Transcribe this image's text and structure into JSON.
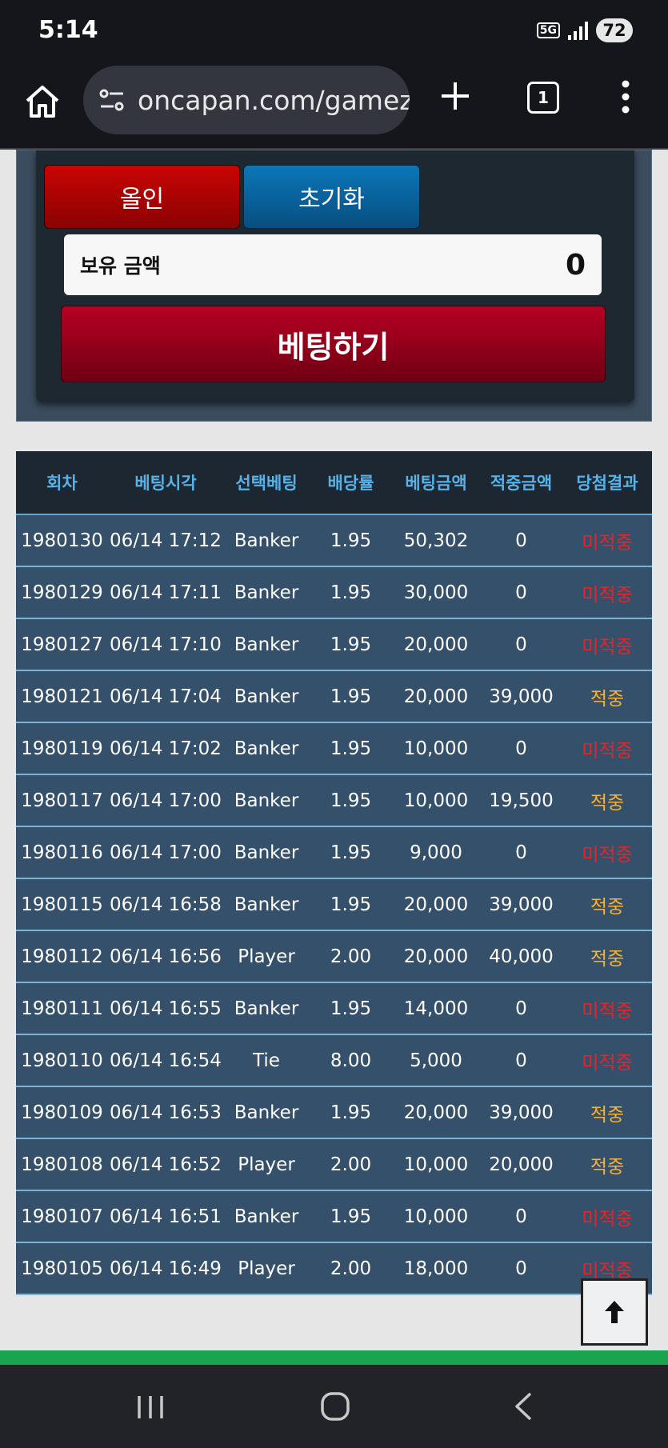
{
  "status_bar": {
    "time": "5:14",
    "network": "5G",
    "battery": "72"
  },
  "browser": {
    "url": "oncapan.com/gamez",
    "tab_count": "1"
  },
  "bet_panel": {
    "allin_label": "올인",
    "reset_label": "초기화",
    "balance_label": "보유 금액",
    "balance_value": "0",
    "bet_button_label": "베팅하기"
  },
  "history": {
    "headers": [
      "회차",
      "베팅시각",
      "선택베팅",
      "배당률",
      "베팅금액",
      "적중금액",
      "당첨결과"
    ],
    "rows": [
      {
        "round": "1980130",
        "time": "06/14 17:12",
        "choice": "Banker",
        "odds": "1.95",
        "amount": "50,302",
        "payout": "0",
        "result": "미적중",
        "win": false
      },
      {
        "round": "1980129",
        "time": "06/14 17:11",
        "choice": "Banker",
        "odds": "1.95",
        "amount": "30,000",
        "payout": "0",
        "result": "미적중",
        "win": false
      },
      {
        "round": "1980127",
        "time": "06/14 17:10",
        "choice": "Banker",
        "odds": "1.95",
        "amount": "20,000",
        "payout": "0",
        "result": "미적중",
        "win": false
      },
      {
        "round": "1980121",
        "time": "06/14 17:04",
        "choice": "Banker",
        "odds": "1.95",
        "amount": "20,000",
        "payout": "39,000",
        "result": "적중",
        "win": true
      },
      {
        "round": "1980119",
        "time": "06/14 17:02",
        "choice": "Banker",
        "odds": "1.95",
        "amount": "10,000",
        "payout": "0",
        "result": "미적중",
        "win": false
      },
      {
        "round": "1980117",
        "time": "06/14 17:00",
        "choice": "Banker",
        "odds": "1.95",
        "amount": "10,000",
        "payout": "19,500",
        "result": "적중",
        "win": true
      },
      {
        "round": "1980116",
        "time": "06/14 17:00",
        "choice": "Banker",
        "odds": "1.95",
        "amount": "9,000",
        "payout": "0",
        "result": "미적중",
        "win": false
      },
      {
        "round": "1980115",
        "time": "06/14 16:58",
        "choice": "Banker",
        "odds": "1.95",
        "amount": "20,000",
        "payout": "39,000",
        "result": "적중",
        "win": true
      },
      {
        "round": "1980112",
        "time": "06/14 16:56",
        "choice": "Player",
        "odds": "2.00",
        "amount": "20,000",
        "payout": "40,000",
        "result": "적중",
        "win": true
      },
      {
        "round": "1980111",
        "time": "06/14 16:55",
        "choice": "Banker",
        "odds": "1.95",
        "amount": "14,000",
        "payout": "0",
        "result": "미적중",
        "win": false
      },
      {
        "round": "1980110",
        "time": "06/14 16:54",
        "choice": "Tie",
        "odds": "8.00",
        "amount": "5,000",
        "payout": "0",
        "result": "미적중",
        "win": false
      },
      {
        "round": "1980109",
        "time": "06/14 16:53",
        "choice": "Banker",
        "odds": "1.95",
        "amount": "20,000",
        "payout": "39,000",
        "result": "적중",
        "win": true
      },
      {
        "round": "1980108",
        "time": "06/14 16:52",
        "choice": "Player",
        "odds": "2.00",
        "amount": "10,000",
        "payout": "20,000",
        "result": "적중",
        "win": true
      },
      {
        "round": "1980107",
        "time": "06/14 16:51",
        "choice": "Banker",
        "odds": "1.95",
        "amount": "10,000",
        "payout": "0",
        "result": "미적중",
        "win": false
      },
      {
        "round": "1980105",
        "time": "06/14 16:49",
        "choice": "Player",
        "odds": "2.00",
        "amount": "18,000",
        "payout": "0",
        "result": "미적중",
        "win": false
      }
    ]
  },
  "icons": {
    "home": "home-icon",
    "site_info": "site-settings-icon",
    "new_tab": "plus-icon",
    "tabs": "tab-switcher-icon",
    "menu": "more-vert-icon",
    "scroll_top": "arrow-up-icon",
    "nav_recent": "recent-apps-icon",
    "nav_home": "home-circle-icon",
    "nav_back": "back-chevron-icon"
  },
  "colors": {
    "win": "#f6b23c",
    "lose": "#e2262a",
    "header_text": "#58b2e8",
    "row_bg": "#35506a"
  }
}
